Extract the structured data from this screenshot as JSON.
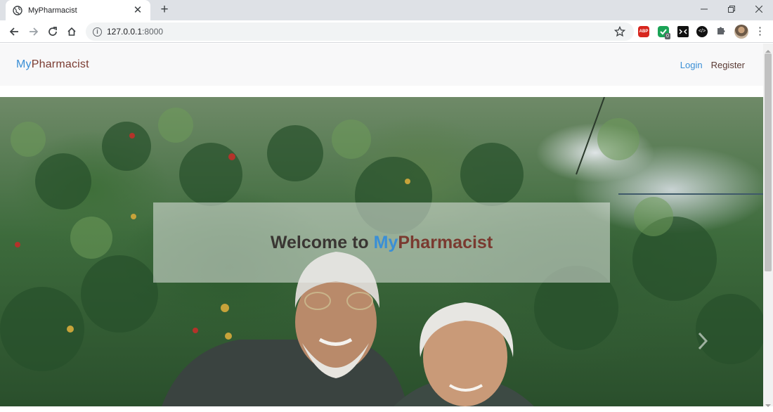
{
  "browser": {
    "tab_title": "MyPharmacist",
    "tab_close": "✕",
    "new_tab": "+",
    "url_host": "127.0.0.1",
    "url_port": ":8000",
    "ext_abp": "ABP",
    "ext_badge": "0",
    "ext_code": "</>",
    "menu": "⋮"
  },
  "navbar": {
    "brand_my": "My",
    "brand_pharmacist": "Pharmacist",
    "login": "Login",
    "register": "Register"
  },
  "hero": {
    "welcome_prefix": "Welcome to ",
    "welcome_my": "My",
    "welcome_pharmacist": "Pharmacist"
  },
  "colors": {
    "brand_my": "#3a8fd6",
    "brand_pharmacist": "#7a3a30",
    "navbar_bg": "#f8f8f9"
  },
  "icons": [
    "globe-icon",
    "close-icon",
    "plus-icon",
    "minimize-icon",
    "restore-icon",
    "window-close-icon",
    "back-arrow-icon",
    "forward-arrow-icon",
    "reload-icon",
    "home-icon",
    "info-icon",
    "star-icon",
    "puzzle-icon",
    "menu-dots-icon",
    "chevron-right-icon"
  ]
}
